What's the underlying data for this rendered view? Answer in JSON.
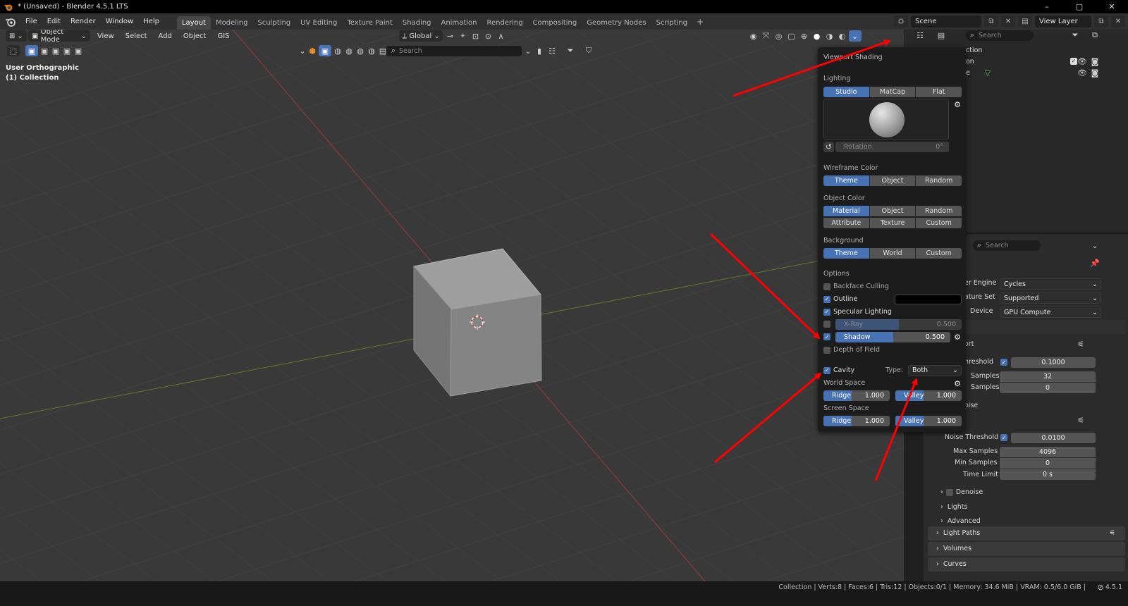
{
  "window": {
    "title": "* (Unsaved) - Blender 4.5.1 LTS",
    "controls": [
      "–",
      "▢",
      "✕"
    ]
  },
  "menubar": {
    "items": [
      "File",
      "Edit",
      "Render",
      "Window",
      "Help"
    ],
    "workspaces": [
      "Layout",
      "Modeling",
      "Sculpting",
      "UV Editing",
      "Texture Paint",
      "Shading",
      "Animation",
      "Rendering",
      "Compositing",
      "Geometry Nodes",
      "Scripting"
    ],
    "active_workspace": "Layout",
    "scene": "Scene",
    "view_layer": "View Layer"
  },
  "viewport": {
    "mode": "Object Mode",
    "menus": [
      "View",
      "Select",
      "Add",
      "Object",
      "GIS"
    ],
    "transform_orientation": "Global",
    "search_placeholder": "Search",
    "view_name": "User Orthographic",
    "collection": "(1) Collection"
  },
  "shading_popover": {
    "title": "Viewport Shading",
    "lighting": {
      "label": "Lighting",
      "options": [
        "Studio",
        "MatCap",
        "Flat"
      ],
      "active": "Studio"
    },
    "rotation": {
      "label": "Rotation",
      "value": "0°"
    },
    "wireframe_color": {
      "label": "Wireframe Color",
      "options": [
        "Theme",
        "Object",
        "Random"
      ],
      "active": "Theme"
    },
    "object_color": {
      "label": "Object Color",
      "row1": [
        "Material",
        "Object",
        "Random"
      ],
      "row2": [
        "Attribute",
        "Texture",
        "Custom"
      ],
      "active": "Material"
    },
    "background": {
      "label": "Background",
      "options": [
        "Theme",
        "World",
        "Custom"
      ],
      "active": "Theme"
    },
    "options_label": "Options",
    "backface_culling": {
      "label": "Backface Culling",
      "checked": false
    },
    "outline": {
      "label": "Outline",
      "checked": true,
      "color": "#000000"
    },
    "specular": {
      "label": "Specular Lighting",
      "checked": true
    },
    "xray": {
      "label": "X-Ray",
      "value": "0.500",
      "fill": 0.5,
      "checked": false
    },
    "shadow": {
      "label": "Shadow",
      "value": "0.500",
      "fill": 0.5,
      "checked": true
    },
    "dof": {
      "label": "Depth of Field",
      "checked": false
    },
    "cavity": {
      "label": "Cavity",
      "checked": true,
      "type_label": "Type:",
      "type_value": "Both"
    },
    "world_space": {
      "label": "World Space",
      "ridge_label": "Ridge",
      "ridge": "1.000",
      "valley_label": "Valley",
      "valley": "1.000"
    },
    "screen_space": {
      "label": "Screen Space",
      "ridge_label": "Ridge",
      "ridge": "1.000",
      "valley_label": "Valley",
      "valley": "1.000"
    }
  },
  "outliner": {
    "search_placeholder": "Search",
    "row1": "ction",
    "row2": "on",
    "row3": "e"
  },
  "properties": {
    "search_placeholder": "Search",
    "render_engine": {
      "label": "er Engine",
      "value": "Cycles"
    },
    "feature_set": {
      "label": "ature Set",
      "value": "Supported"
    },
    "device": {
      "label": "Device",
      "value": "GPU Compute"
    },
    "viewport_label": "ort",
    "vp_threshold": {
      "label": "hreshold",
      "value": "0.1000"
    },
    "vp_max": {
      "label": "Samples",
      "value": "32"
    },
    "vp_min": {
      "label": "Samples",
      "value": "0"
    },
    "oise_label": "oise",
    "noise_threshold": {
      "label": "Noise Threshold",
      "value": "0.0100"
    },
    "max_samples": {
      "label": "Max Samples",
      "value": "4096"
    },
    "min_samples": {
      "label": "Min Samples",
      "value": "0"
    },
    "time_limit": {
      "label": "Time Limit",
      "value": "0 s"
    },
    "denoise": "Denoise",
    "lights": "Lights",
    "advanced": "Advanced",
    "light_paths": "Light Paths",
    "volumes": "Volumes",
    "curves": "Curves"
  },
  "statusbar": {
    "stats": "Collection | Verts:8 | Faces:6 | Tris:12 | Objects:0/1 | Memory: 34.6 MiB | VRAM: 0.5/6.0 GiB |",
    "version": "4.5.1"
  },
  "colors": {
    "accent": "#4772b3",
    "viewport_bg": "#393939",
    "annotation_arrow": "#ff0000"
  }
}
